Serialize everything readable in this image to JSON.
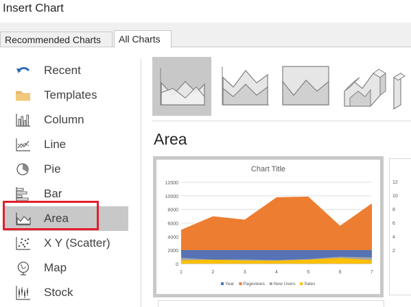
{
  "window": {
    "title": "Insert Chart"
  },
  "tabs": [
    {
      "label": "Recommended Charts",
      "active": false
    },
    {
      "label": "All Charts",
      "active": true
    }
  ],
  "sidebar": {
    "items": [
      {
        "label": "Recent",
        "icon": "undo-arrow-icon"
      },
      {
        "label": "Templates",
        "icon": "folder-icon"
      },
      {
        "label": "Column",
        "icon": "column-chart-icon"
      },
      {
        "label": "Line",
        "icon": "line-chart-icon"
      },
      {
        "label": "Pie",
        "icon": "pie-chart-icon"
      },
      {
        "label": "Bar",
        "icon": "bar-chart-icon"
      },
      {
        "label": "Area",
        "icon": "area-chart-icon",
        "selected": true
      },
      {
        "label": "X Y (Scatter)",
        "icon": "scatter-chart-icon"
      },
      {
        "label": "Map",
        "icon": "globe-icon"
      },
      {
        "label": "Stock",
        "icon": "stock-chart-icon"
      }
    ]
  },
  "subtypes": [
    {
      "icon": "area-chart-icon",
      "selected": true
    },
    {
      "icon": "stacked-area-chart-icon"
    },
    {
      "icon": "100-percent-stacked-area-chart-icon"
    },
    {
      "icon": "3d-area-chart-icon"
    },
    {
      "icon": "3d-stacked-area-chart-icon"
    }
  ],
  "section": {
    "title": "Area"
  },
  "colors": {
    "accent_red": "#e21d2b",
    "selection_gray": "#c8c8c8",
    "series_year": "#4472c4",
    "series_pageviews": "#ed7d31",
    "series_new_users": "#a5a5a5",
    "series_sales": "#ffc000"
  },
  "chart_data": {
    "type": "area",
    "title": "Chart Title",
    "x": [
      1,
      2,
      3,
      4,
      5,
      6,
      7
    ],
    "ylim": [
      0,
      12000
    ],
    "yticks": [
      0,
      2000,
      4000,
      6000,
      8000,
      10000,
      12000
    ],
    "grid": true,
    "legend": "bottom",
    "series": [
      {
        "name": "Year",
        "color": "#4472c4",
        "values": [
          2014,
          2015,
          2016,
          2017,
          2018,
          2019,
          2020
        ]
      },
      {
        "name": "Pageviews",
        "color": "#ed7d31",
        "values": [
          5000,
          7000,
          6500,
          9800,
          9900,
          5600,
          8900
        ]
      },
      {
        "name": "New Users",
        "color": "#a5a5a5",
        "values": [
          900,
          600,
          650,
          550,
          700,
          1050,
          950
        ]
      },
      {
        "name": "Sales",
        "color": "#ffc000",
        "values": [
          500,
          620,
          480,
          450,
          600,
          850,
          550
        ]
      }
    ]
  }
}
